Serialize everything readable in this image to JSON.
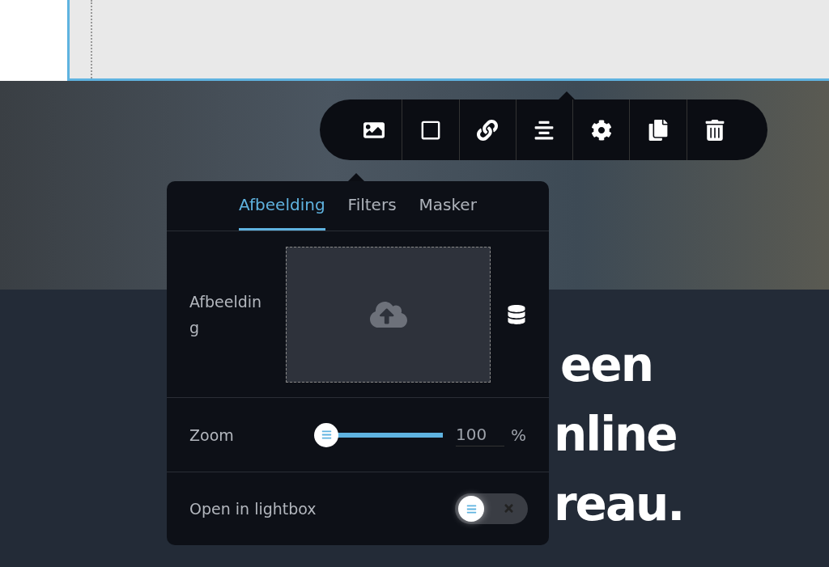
{
  "headline": {
    "line_1": "een",
    "line_2": "nline",
    "line_3": "reau."
  },
  "panel": {
    "tabs": [
      {
        "label": "Afbeelding",
        "selected": true
      },
      {
        "label": "Filters",
        "selected": false
      },
      {
        "label": "Masker",
        "selected": false
      }
    ],
    "image_label": "Afbeelding",
    "zoom": {
      "label": "Zoom",
      "level": 0,
      "value": "100",
      "unit": "%"
    },
    "lightbox": {
      "label": "Open in lightbox",
      "on": false
    }
  }
}
